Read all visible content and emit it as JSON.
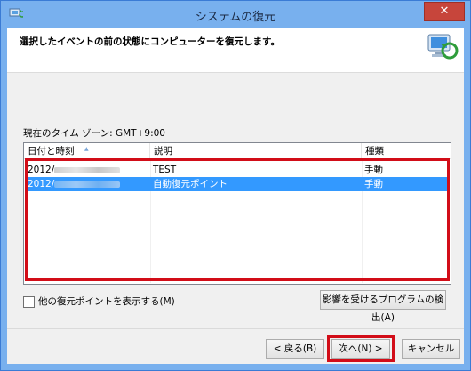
{
  "window": {
    "title": "システムの復元",
    "close_label": "✕"
  },
  "header": {
    "instruction": "選択したイベントの前の状態にコンピューターを復元します。"
  },
  "timezone": "現在のタイム ゾーン: GMT+9:00",
  "table": {
    "columns": [
      "日付と時刻",
      "説明",
      "種類"
    ],
    "rows": [
      {
        "date": "2012/",
        "description": "TEST",
        "type": "手動",
        "selected": false
      },
      {
        "date": "2012/",
        "description": "自動復元ポイント",
        "type": "手動",
        "selected": true
      }
    ]
  },
  "checkbox": {
    "label": "他の復元ポイントを表示する(M)",
    "checked": false
  },
  "buttons": {
    "detect": "影響を受けるプログラムの検出(A)",
    "back": "< 戻る(B)",
    "next": "次へ(N) >",
    "cancel": "キャンセル"
  },
  "colors": {
    "highlight": "#d20d18",
    "selection": "#3399ff",
    "titlebar": "#78b0ee"
  }
}
